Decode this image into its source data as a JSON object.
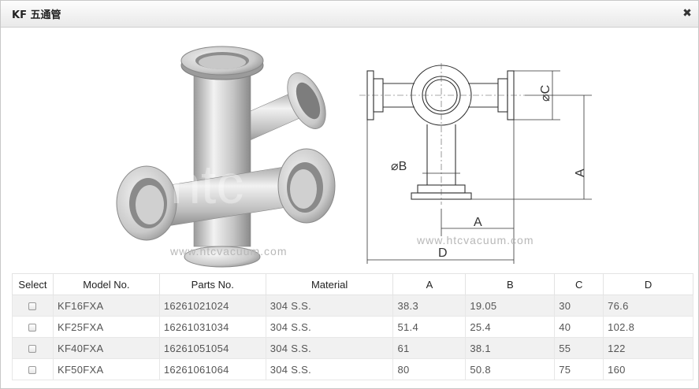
{
  "dialog": {
    "title": "KF 五通管",
    "close_glyph": "✖"
  },
  "figure": {
    "watermark_left": "www.htcvacuum.com",
    "watermark_right": "www.htcvacuum.com",
    "logo_text": "htc",
    "dim_labels": {
      "oc": "⌀C",
      "ob": "⌀B",
      "a_vertical": "A",
      "a_horizontal": "A",
      "d": "D"
    }
  },
  "table": {
    "headers": [
      "Select",
      "Model No.",
      "Parts No.",
      "Material",
      "A",
      "B",
      "C",
      "D"
    ],
    "rows": [
      {
        "model": "KF16FXA",
        "parts": "16261021024",
        "material": "304 S.S.",
        "a": "38.3",
        "b": "19.05",
        "c": "30",
        "d": "76.6"
      },
      {
        "model": "KF25FXA",
        "parts": "16261031034",
        "material": "304 S.S.",
        "a": "51.4",
        "b": "25.4",
        "c": "40",
        "d": "102.8"
      },
      {
        "model": "KF40FXA",
        "parts": "16261051054",
        "material": "304 S.S.",
        "a": "61",
        "b": "38.1",
        "c": "55",
        "d": "122"
      },
      {
        "model": "KF50FXA",
        "parts": "16261061064",
        "material": "304 S.S.",
        "a": "80",
        "b": "50.8",
        "c": "75",
        "d": "160"
      }
    ]
  }
}
